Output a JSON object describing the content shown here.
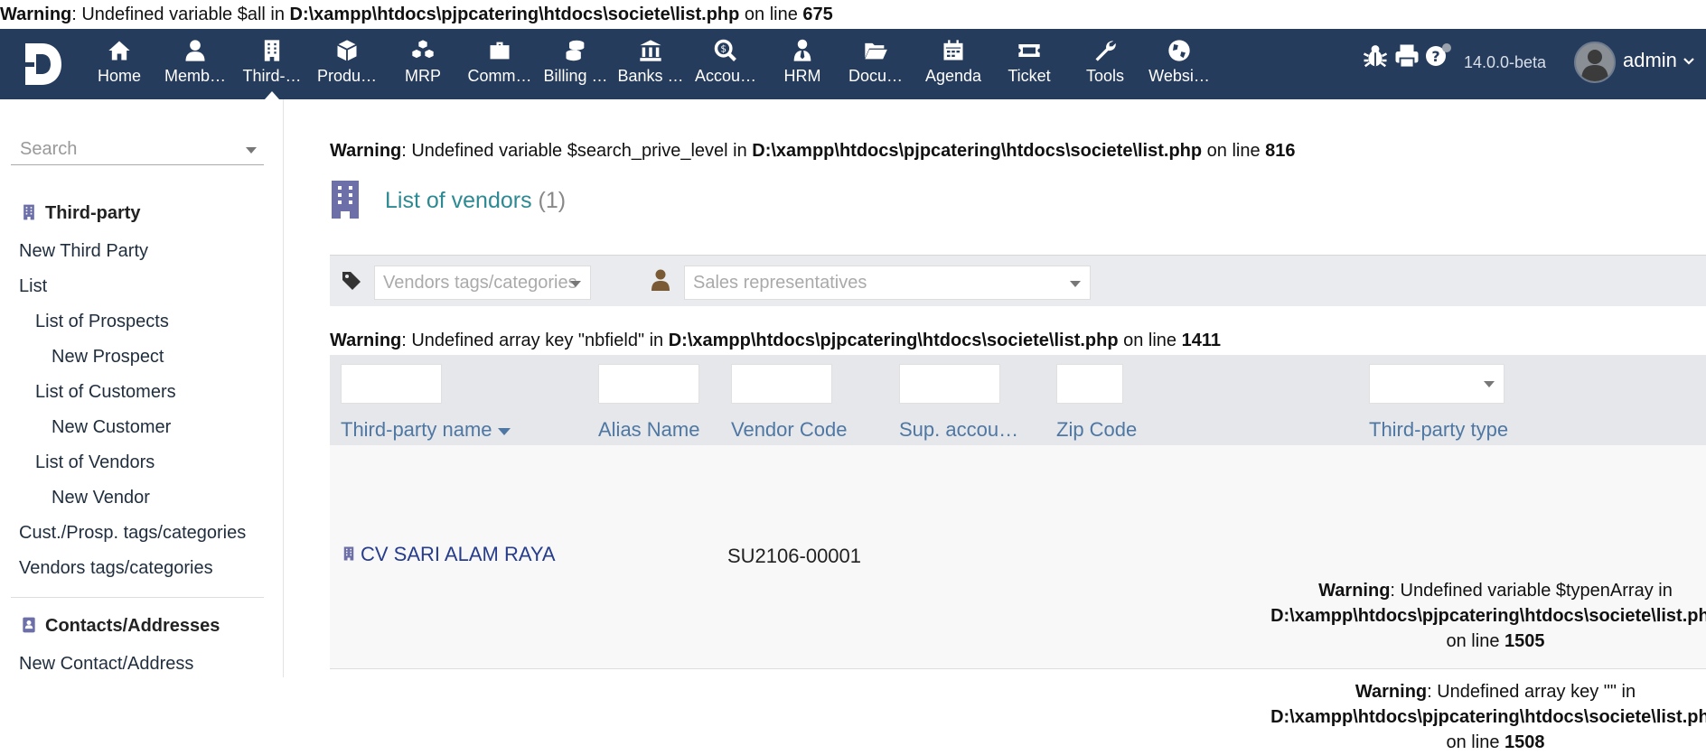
{
  "warnings": {
    "top": {
      "label": "Warning",
      "msg": ": Undefined variable $all in ",
      "path": "D:\\xampp\\htdocs\\pjpcatering\\htdocs\\societe\\list.php",
      "online": " on line ",
      "line": "675"
    },
    "w816": {
      "label": "Warning",
      "msg": ": Undefined variable $search_prive_level in ",
      "path": "D:\\xampp\\htdocs\\pjpcatering\\htdocs\\societe\\list.php",
      "online": " on line ",
      "line": "816"
    },
    "w1411": {
      "label": "Warning",
      "msg": ": Undefined array key \"nbfield\" in ",
      "path": "D:\\xampp\\htdocs\\pjpcatering\\htdocs\\societe\\list.php",
      "online": " on line ",
      "line": "1411"
    },
    "w1505": {
      "label": "Warning",
      "msg": ": Undefined variable $typenArray in",
      "path": "D:\\xampp\\htdocs\\pjpcatering\\htdocs\\societe\\list.php",
      "online": "on line ",
      "line": "1505"
    },
    "w1508": {
      "label": "Warning",
      "msg": ": Undefined array key \"\" in",
      "path": "D:\\xampp\\htdocs\\pjpcatering\\htdocs\\societe\\list.php",
      "online": "on line ",
      "line": "1508"
    }
  },
  "nav": {
    "items": [
      {
        "label": "Home",
        "icon": "home-icon"
      },
      {
        "label": "Memb…",
        "icon": "member-icon"
      },
      {
        "label": "Third-…",
        "icon": "building-icon"
      },
      {
        "label": "Produ…",
        "icon": "cube-icon"
      },
      {
        "label": "MRP",
        "icon": "cubes-icon"
      },
      {
        "label": "Comm…",
        "icon": "briefcase-icon"
      },
      {
        "label": "Billing …",
        "icon": "coins-icon"
      },
      {
        "label": "Banks …",
        "icon": "bank-icon"
      },
      {
        "label": "Accou…",
        "icon": "search-dollar-icon"
      },
      {
        "label": "HRM",
        "icon": "user-tie-icon"
      },
      {
        "label": "Docu…",
        "icon": "folder-icon"
      },
      {
        "label": "Agenda",
        "icon": "calendar-icon"
      },
      {
        "label": "Ticket",
        "icon": "ticket-icon"
      },
      {
        "label": "Tools",
        "icon": "wrench-icon"
      },
      {
        "label": "Websi…",
        "icon": "globe-icon"
      }
    ],
    "version": "14.0.0-beta",
    "user": "admin",
    "bg_color": "#263c5c"
  },
  "sidebar": {
    "search_placeholder": "Search",
    "items": [
      {
        "label": "Third-party"
      },
      {
        "label": "New Third Party"
      },
      {
        "label": "List"
      },
      {
        "label": "List of Prospects"
      },
      {
        "label": "New Prospect"
      },
      {
        "label": "List of Customers"
      },
      {
        "label": "New Customer"
      },
      {
        "label": "List of Vendors"
      },
      {
        "label": "New Vendor"
      },
      {
        "label": "Cust./Prosp. tags/categories"
      },
      {
        "label": "Vendors tags/categories"
      },
      {
        "label": "Contacts/Addresses"
      },
      {
        "label": "New Contact/Address"
      }
    ]
  },
  "main": {
    "title": "List of vendors",
    "count": "(1)",
    "filters": {
      "tags": "Vendors tags/categories",
      "sales": "Sales representatives"
    },
    "columns": [
      "Third-party name",
      "Alias Name",
      "Vendor Code",
      "Sup. accou…",
      "Zip Code",
      "Third-party type"
    ],
    "row": {
      "name": "CV SARI ALAM RAYA",
      "code": "SU2106-00001"
    }
  }
}
